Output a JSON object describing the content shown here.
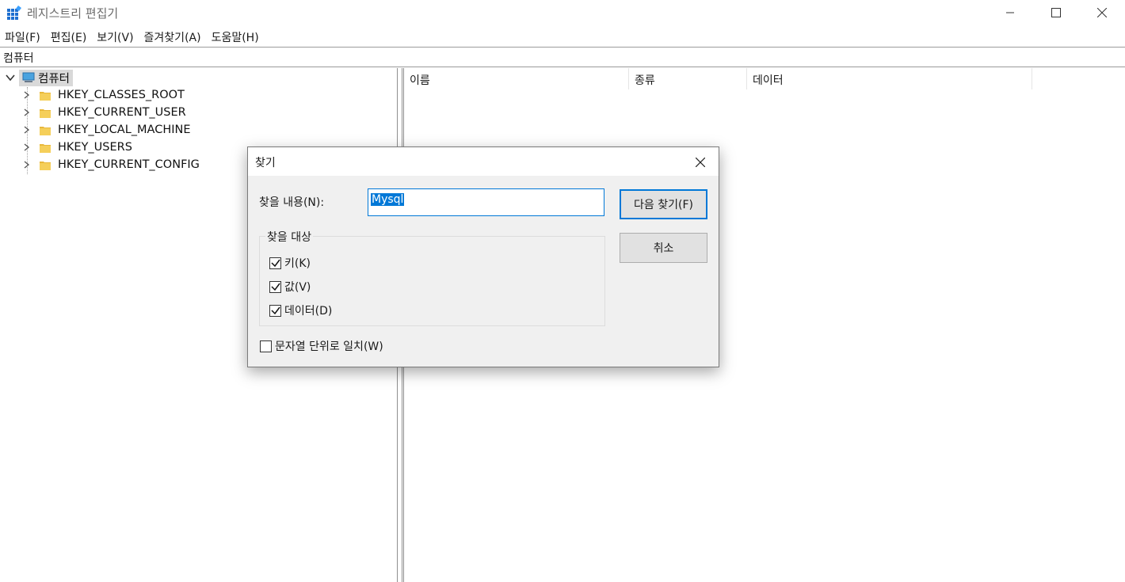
{
  "window": {
    "title": "레지스트리 편집기"
  },
  "menu": [
    "파일(F)",
    "편집(E)",
    "보기(V)",
    "즐겨찾기(A)",
    "도움말(H)"
  ],
  "address": "컴퓨터",
  "tree": {
    "root": "컴퓨터",
    "children": [
      "HKEY_CLASSES_ROOT",
      "HKEY_CURRENT_USER",
      "HKEY_LOCAL_MACHINE",
      "HKEY_USERS",
      "HKEY_CURRENT_CONFIG"
    ]
  },
  "list": {
    "columns": [
      "이름",
      "종류",
      "데이터"
    ]
  },
  "dialog": {
    "title": "찾기",
    "find_label": "찾을 내용(N):",
    "find_value": "Mysql",
    "find_next": "다음 찾기(F)",
    "cancel": "취소",
    "group_label": "찾을 대상",
    "options": [
      {
        "label": "키(K)",
        "checked": true
      },
      {
        "label": "값(V)",
        "checked": true
      },
      {
        "label": "데이터(D)",
        "checked": true
      }
    ],
    "match_whole": {
      "label": "문자열 단위로 일치(W)",
      "checked": false
    }
  },
  "colors": {
    "accent": "#0078d7",
    "folder": "#e8b83c",
    "selection": "#d9d9d9"
  }
}
